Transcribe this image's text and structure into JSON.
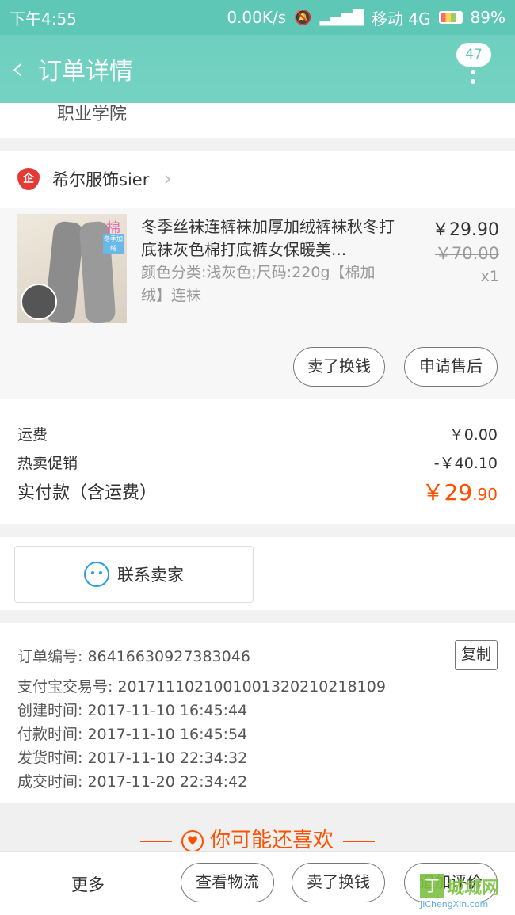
{
  "status_bar": {
    "time": "下午4:55",
    "speed": "0.00K/s",
    "carrier": "移动 4G",
    "battery": "89%"
  },
  "nav": {
    "title": "订单详情",
    "badge": "47"
  },
  "address_tail": "职业学院",
  "shop": {
    "name": "希尔服饰sier",
    "icon_text": "企"
  },
  "item": {
    "title": "冬季丝袜连裤袜加厚加绒裤袜秋冬打底袜灰色棉打底裤女保暖美...",
    "sku": "颜色分类:浅灰色;尺码:220g【棉加绒】连袜",
    "price": "￥29.90",
    "original_price": "￥70.00",
    "quantity": "x1",
    "thumb_tag": "棉",
    "thumb_tag2": "冬季加绒",
    "buttons": [
      "卖了换钱",
      "申请售后"
    ]
  },
  "fees": {
    "shipping_label": "运费",
    "shipping_value": "￥0.00",
    "promo_label": "热卖促销",
    "promo_value": "-￥40.10",
    "total_label": "实付款（含运费）",
    "total_value_main": "￥29",
    "total_value_decimal": ".90"
  },
  "contact": {
    "label": "联系卖家"
  },
  "order_info": {
    "order_no": "订单编号: 86416630927383046",
    "copy_label": "复制",
    "alipay_no": "支付宝交易号: 2017111021001001320210218109",
    "created": "创建时间: 2017-11-10 16:45:44",
    "paid": "付款时间: 2017-11-10 16:45:54",
    "shipped": "发货时间: 2017-11-10 22:34:32",
    "completed": "成交时间: 2017-11-20 22:34:42"
  },
  "recommend": {
    "title": "你可能还喜欢"
  },
  "bottom_bar": {
    "more": "更多",
    "buttons": [
      "查看物流",
      "卖了换钱",
      "追加评价"
    ]
  },
  "watermark": {
    "logo_char": "丁",
    "text": "城城网",
    "url": "JiChengXin.com"
  },
  "colors": {
    "header": "#74d2c2",
    "accent": "#ff5000",
    "link": "#2d9de0"
  }
}
